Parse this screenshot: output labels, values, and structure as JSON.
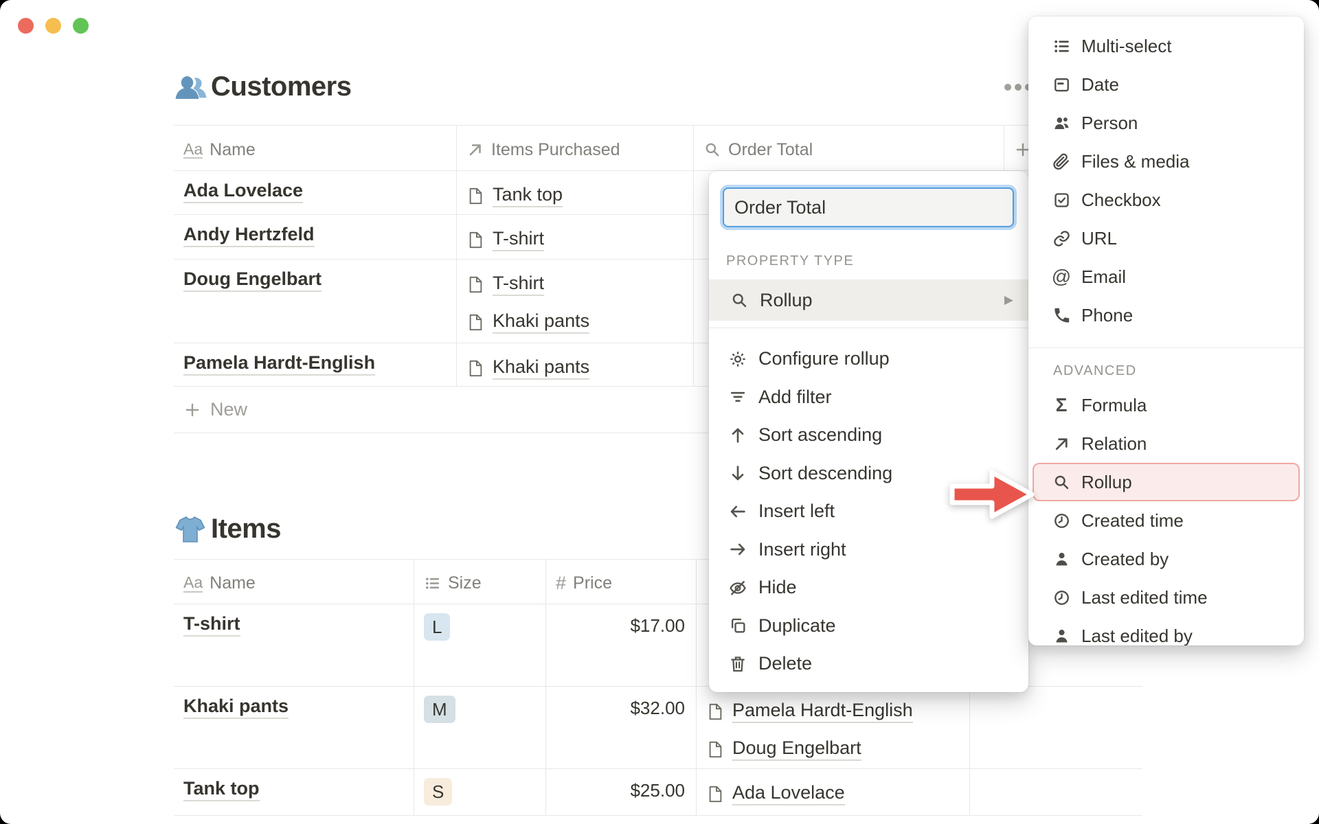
{
  "window": {
    "traffic_lights": {
      "close": "close",
      "minimize": "minimize",
      "zoom": "zoom"
    }
  },
  "header": {
    "more_options": "•••"
  },
  "customers": {
    "title": "Customers",
    "title_icon": "busts-in-silhouette-emoji",
    "columns": [
      {
        "icon": "text-icon",
        "label": "Name"
      },
      {
        "icon": "relation-icon",
        "label": "Items Purchased"
      },
      {
        "icon": "rollup-icon",
        "label": "Order Total"
      },
      {
        "icon": "plus-icon",
        "label": ""
      }
    ],
    "rows": [
      {
        "name": "Ada Lovelace",
        "items": [
          "Tank top"
        ]
      },
      {
        "name": "Andy Hertzfeld",
        "items": [
          "T-shirt"
        ]
      },
      {
        "name": "Doug Engelbart",
        "items": [
          "T-shirt",
          "Khaki pants"
        ]
      },
      {
        "name": "Pamela Hardt-English",
        "items": [
          "Khaki pants"
        ]
      }
    ],
    "new_row_label": "New"
  },
  "items": {
    "title": "Items",
    "title_icon": "t-shirt-emoji",
    "columns": [
      {
        "icon": "text-icon",
        "label": "Name"
      },
      {
        "icon": "list-icon",
        "label": "Size"
      },
      {
        "icon": "number-icon",
        "label": "Price"
      },
      {
        "icon": "",
        "label": ""
      },
      {
        "icon": "",
        "label": ""
      }
    ],
    "rows": [
      {
        "name": "T-shirt",
        "size": "L",
        "size_color": "#D7E6EF",
        "price": "$17.00",
        "purchased_by": []
      },
      {
        "name": "Khaki pants",
        "size": "M",
        "size_color": "#D4E0E4",
        "price": "$32.00",
        "purchased_by": [
          "Pamela Hardt-English",
          "Doug Engelbart"
        ]
      },
      {
        "name": "Tank top",
        "size": "S",
        "size_color": "#F8ECDD",
        "price": "$25.00",
        "purchased_by": [
          "Ada Lovelace"
        ]
      }
    ]
  },
  "property_menu": {
    "name_input_value": "Order Total",
    "section_label": "PROPERTY TYPE",
    "current_type": {
      "icon": "rollup-icon",
      "label": "Rollup",
      "chevron": "▶"
    },
    "items": [
      {
        "icon": "gear-icon",
        "label": "Configure rollup"
      },
      {
        "icon": "filter-icon",
        "label": "Add filter"
      },
      {
        "icon": "arrow-up-icon",
        "label": "Sort ascending"
      },
      {
        "icon": "arrow-down-icon",
        "label": "Sort descending"
      },
      {
        "icon": "arrow-left-icon",
        "label": "Insert left"
      },
      {
        "icon": "arrow-right-icon",
        "label": "Insert right"
      },
      {
        "icon": "eye-off-icon",
        "label": "Hide"
      },
      {
        "icon": "duplicate-icon",
        "label": "Duplicate"
      },
      {
        "icon": "trash-icon",
        "label": "Delete"
      }
    ]
  },
  "type_menu": {
    "basic_items": [
      {
        "icon": "list-icon",
        "label": "Multi-select"
      },
      {
        "icon": "calendar-icon",
        "label": "Date"
      },
      {
        "icon": "people-icon",
        "label": "Person"
      },
      {
        "icon": "paperclip-icon",
        "label": "Files & media"
      },
      {
        "icon": "checkbox-icon",
        "label": "Checkbox"
      },
      {
        "icon": "link-icon",
        "label": "URL"
      },
      {
        "icon": "at-icon",
        "label": "Email"
      },
      {
        "icon": "phone-icon",
        "label": "Phone"
      }
    ],
    "advanced_label": "ADVANCED",
    "advanced_items": [
      {
        "icon": "sigma-icon",
        "label": "Formula"
      },
      {
        "icon": "relation-icon",
        "label": "Relation"
      },
      {
        "icon": "rollup-icon",
        "label": "Rollup",
        "highlighted": true
      },
      {
        "icon": "clock-icon",
        "label": "Created time"
      },
      {
        "icon": "person-icon",
        "label": "Created by"
      },
      {
        "icon": "clock-icon",
        "label": "Last edited time"
      },
      {
        "icon": "person-icon",
        "label": "Last edited by"
      }
    ]
  },
  "annotation": {
    "shape": "red-arrow-pointing-right",
    "target": "Rollup"
  },
  "colors": {
    "text": "#37352F",
    "header_gray": "#82807B",
    "table_border": "#E8E7E4",
    "focus_blue": "#549FE0",
    "highlight_bg": "#FBECEB",
    "highlight_border": "#F0A8A3",
    "arrow_red": "#E8554D",
    "traffic_red": "#EC6A5E",
    "traffic_yellow": "#F5BE4F",
    "traffic_green": "#61C455"
  }
}
